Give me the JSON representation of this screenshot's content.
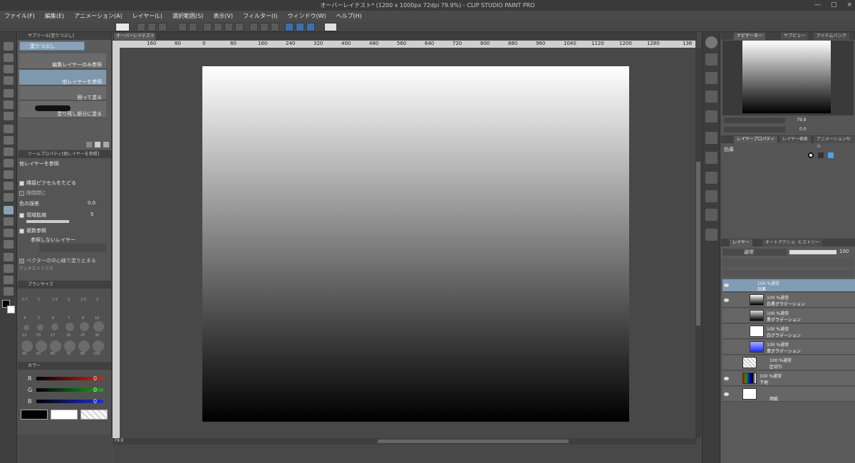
{
  "window": {
    "title": "オーバーレイテスト* (1200 x 1000px 72dpi 79.9%) - CLIP STUDIO PAINT PRO",
    "controls": [
      "—",
      "□",
      "×"
    ]
  },
  "menu": [
    "ファイル(F)",
    "編集(E)",
    "アニメーション(A)",
    "レイヤー(L)",
    "選択範囲(S)",
    "表示(V)",
    "フィルター(I)",
    "ウィンドウ(W)",
    "ヘルプ(H)"
  ],
  "subtool": {
    "header": "サブツール[塗りつぶし]",
    "tab": "塗りつぶし",
    "items": [
      {
        "label": "編集レイヤーのみ参照"
      },
      {
        "label": "他レイヤーを参照"
      },
      {
        "label": "囲って塗る"
      },
      {
        "label": "塗り残し部分に塗る"
      }
    ]
  },
  "toolprop": {
    "header": "ツールプロパティ[他レイヤーを参照]",
    "title": "他レイヤーを参照",
    "rows": {
      "r1": "隣接ピクセルをたどる",
      "r2": "隙間閉じ",
      "r3": "色の誤差",
      "r3_value": "0.0",
      "r4": "領域拡縮",
      "r4_value": "5",
      "r5": "複数参照",
      "r6": "参照しないレイヤー",
      "r7": "ベクターの中心線で塗り止まる",
      "r8": "アンチエイリアス"
    }
  },
  "brushsize": {
    "header": "ブラシサイズ",
    "sizes": [
      "0.7",
      "1",
      "1.5",
      "2",
      "2.5",
      "3",
      "4",
      "5",
      "6",
      "7",
      "8",
      "10",
      "12",
      "15",
      "17",
      "20",
      "25",
      "30",
      "40",
      "50",
      "60",
      "70",
      "80",
      "100"
    ]
  },
  "color": {
    "header": "カラー",
    "channels": [
      {
        "label": "R",
        "value": "0",
        "color": "#d32020"
      },
      {
        "label": "G",
        "value": "0",
        "color": "#20a020"
      },
      {
        "label": "B",
        "value": "0",
        "color": "#2030d0"
      }
    ]
  },
  "canvas": {
    "tab": "オーバーレイテスト*",
    "zoom": "79.9"
  },
  "ruler_labels": [
    "160",
    "80",
    "0",
    "80",
    "160",
    "240",
    "320",
    "400",
    "480",
    "560",
    "640",
    "720",
    "800",
    "880",
    "960",
    "1040",
    "1120",
    "1200",
    "1280",
    "136"
  ],
  "navigator": {
    "tabs": [
      "ナビゲーター",
      "サブビュー",
      "アイテムバンク"
    ],
    "zoom": "79.9",
    "angle": "0.0"
  },
  "layerprop": {
    "tabs": [
      "レイヤープロパティ",
      "レイヤー検索",
      "アニメーションセル"
    ],
    "effect_label": "効果"
  },
  "layers": {
    "tabs": [
      "レイヤー",
      "オートアクション",
      "ヒストリー"
    ],
    "blend": "通常",
    "opacity": "100",
    "items": [
      {
        "mode": "100 %通常",
        "name": "効果",
        "type": "folder"
      },
      {
        "mode": "100 %通常",
        "name": "白黒グラデーション",
        "type": "layer"
      },
      {
        "mode": "100 %通常",
        "name": "黒グラデーション",
        "type": "layer"
      },
      {
        "mode": "100 %通常",
        "name": "白グラデーション",
        "type": "layer"
      },
      {
        "mode": "100 %通常",
        "name": "青グラデーション",
        "type": "layer"
      },
      {
        "mode": "100 %通常",
        "name": "区切り",
        "type": "layer"
      },
      {
        "mode": "100 %通常",
        "name": "下地",
        "type": "layer"
      },
      {
        "mode": "",
        "name": "用紙",
        "type": "paper"
      }
    ]
  }
}
